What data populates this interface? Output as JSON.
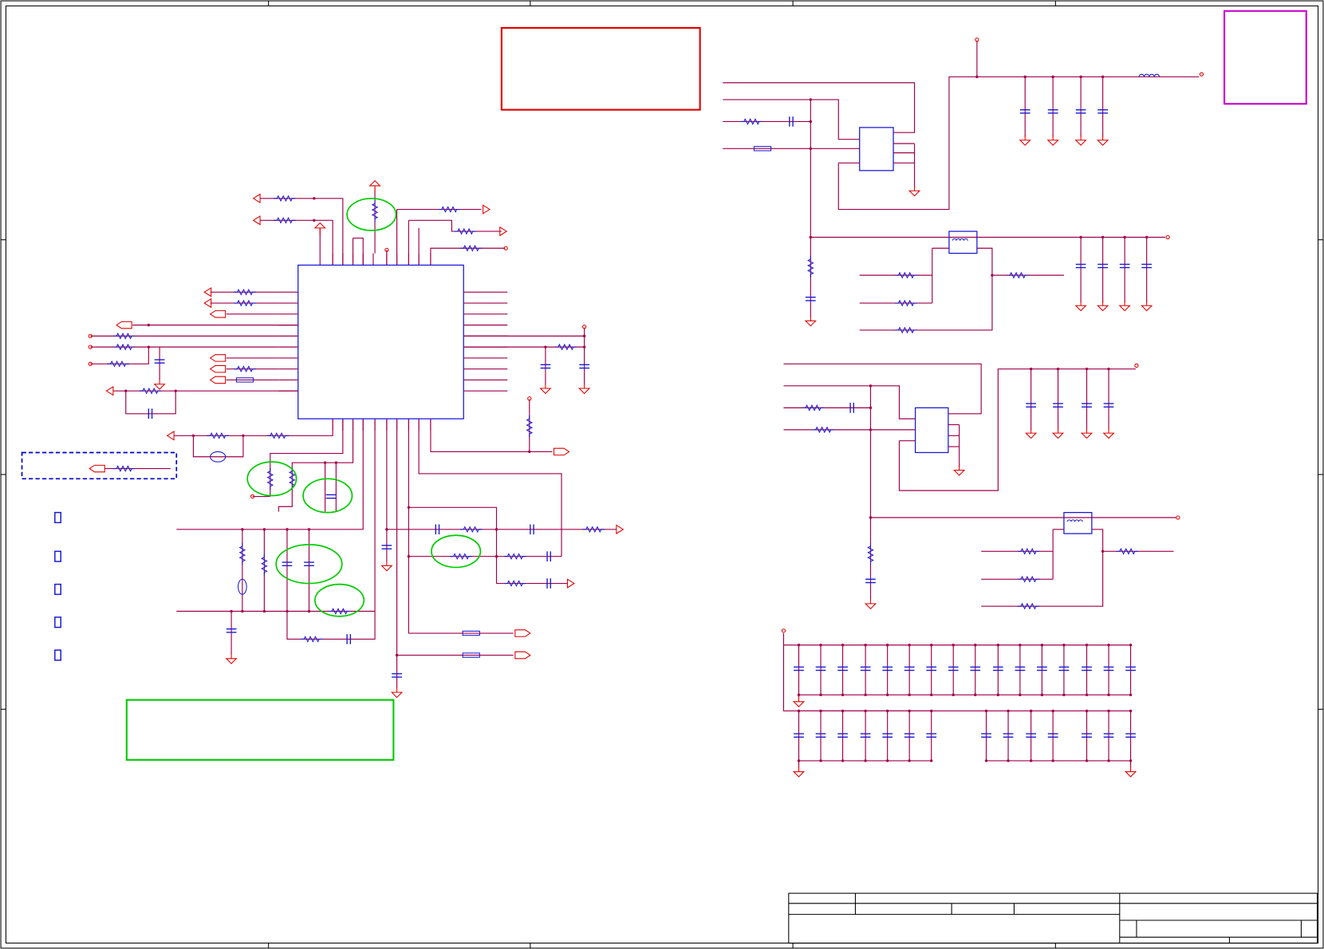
{
  "sheet": {
    "colors": {
      "wire": "#a0004a",
      "component": "#1a1ad6",
      "power": "#e00000",
      "frame": "#000000",
      "highlight_circle": "#00cc00",
      "note_red": "#e00000",
      "note_magenta": "#cc00cc",
      "note_green": "#00cc00",
      "note_blue_dashed": "#0000cc"
    },
    "icons": {
      "resistor": "resistor-icon",
      "capacitor": "capacitor-icon",
      "ground": "ground-icon",
      "power_arrow": "power-arrow-icon",
      "port": "port-icon",
      "inductor": "inductor-icon",
      "crystal": "crystal-icon",
      "ic": "ic-icon"
    }
  }
}
